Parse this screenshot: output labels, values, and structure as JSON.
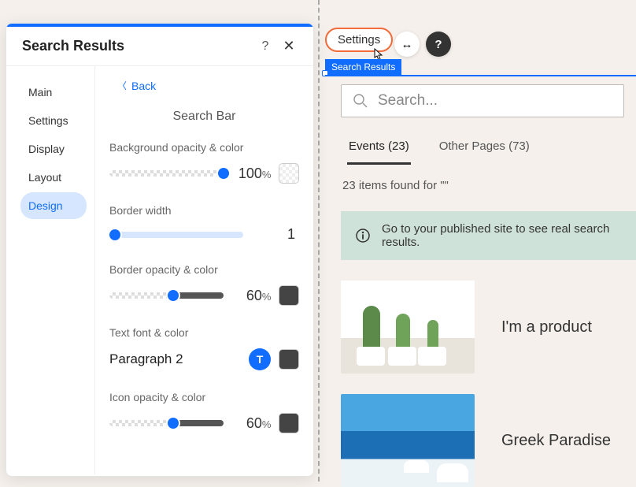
{
  "panel": {
    "title": "Search Results",
    "help_icon": "?",
    "close_icon": "✕",
    "nav": [
      "Main",
      "Settings",
      "Display",
      "Layout",
      "Design"
    ],
    "nav_active": "Design",
    "back_label": "Back",
    "section_title": "Search Bar",
    "controls": {
      "bg_opacity": {
        "label": "Background opacity & color",
        "value": "100",
        "unit": "%"
      },
      "border_width": {
        "label": "Border width",
        "value": "1"
      },
      "border_opacity": {
        "label": "Border opacity & color",
        "value": "60",
        "unit": "%"
      },
      "text_font": {
        "label": "Text font & color",
        "font_name": "Paragraph 2",
        "btn_glyph": "T"
      },
      "icon_opacity": {
        "label": "Icon opacity & color",
        "value": "60",
        "unit": "%"
      }
    }
  },
  "canvas": {
    "settings_button": "Settings",
    "stretch_glyph": "↔",
    "help_glyph": "?",
    "element_label": "Search Results",
    "search_placeholder": "Search...",
    "tabs": [
      {
        "label": "Events (23)",
        "active": true
      },
      {
        "label": "Other Pages (73)",
        "active": false
      }
    ],
    "results_message": "23 items found for \"\"",
    "notice_text": "Go to your published site to see real search results.",
    "results": [
      {
        "title": "I'm a product",
        "thumb": "cactus"
      },
      {
        "title": "Greek Paradise",
        "thumb": "greece"
      }
    ]
  }
}
